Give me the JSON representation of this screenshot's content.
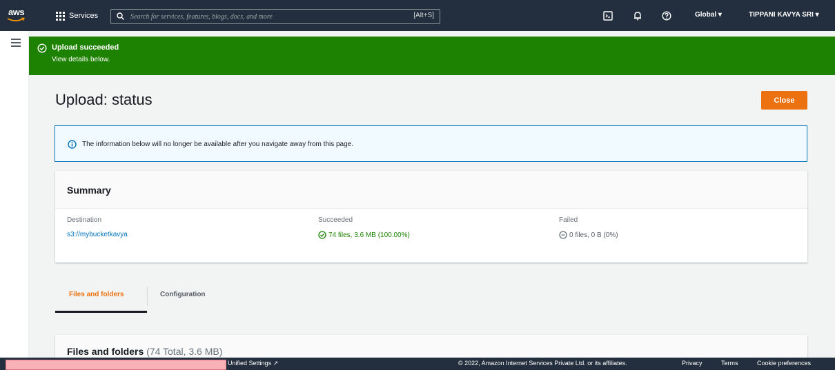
{
  "topnav": {
    "logo_text": "aws",
    "services_label": "Services",
    "search_placeholder": "Search for services, features, blogs, docs, and more",
    "search_shortcut": "[Alt+S]",
    "region_label": "Global ▾",
    "account_label": "TIPPANI KAVYA SRI ▾",
    "icons": [
      "cloudshell-icon",
      "bell-icon",
      "help-icon"
    ]
  },
  "banner": {
    "title": "Upload succeeded",
    "subtitle": "View details below.",
    "color": "#1d8102"
  },
  "page": {
    "title": "Upload: status",
    "close_label": "Close",
    "accent": "#ec7211"
  },
  "info": {
    "message": "The information below will no longer be available after you navigate away from this page."
  },
  "summary": {
    "heading": "Summary",
    "destination_label": "Destination",
    "destination_value": "s3://mybucketkavya",
    "succeeded_label": "Succeeded",
    "succeeded_value": "74 files, 3.6 MB (100.00%)",
    "failed_label": "Failed",
    "failed_value": "0 files, 0 B (0%)"
  },
  "tabs": [
    {
      "label": "Files and folders",
      "active": true
    },
    {
      "label": "Configuration",
      "active": false
    }
  ],
  "files": {
    "heading": "Files and folders",
    "count": "(74 Total, 3.6 MB)"
  },
  "footer": {
    "unified_settings": "Unified Settings",
    "copyright": "© 2022, Amazon Internet Services Private Ltd. or its affiliates.",
    "privacy": "Privacy",
    "terms": "Terms",
    "cookie": "Cookie preferences"
  }
}
